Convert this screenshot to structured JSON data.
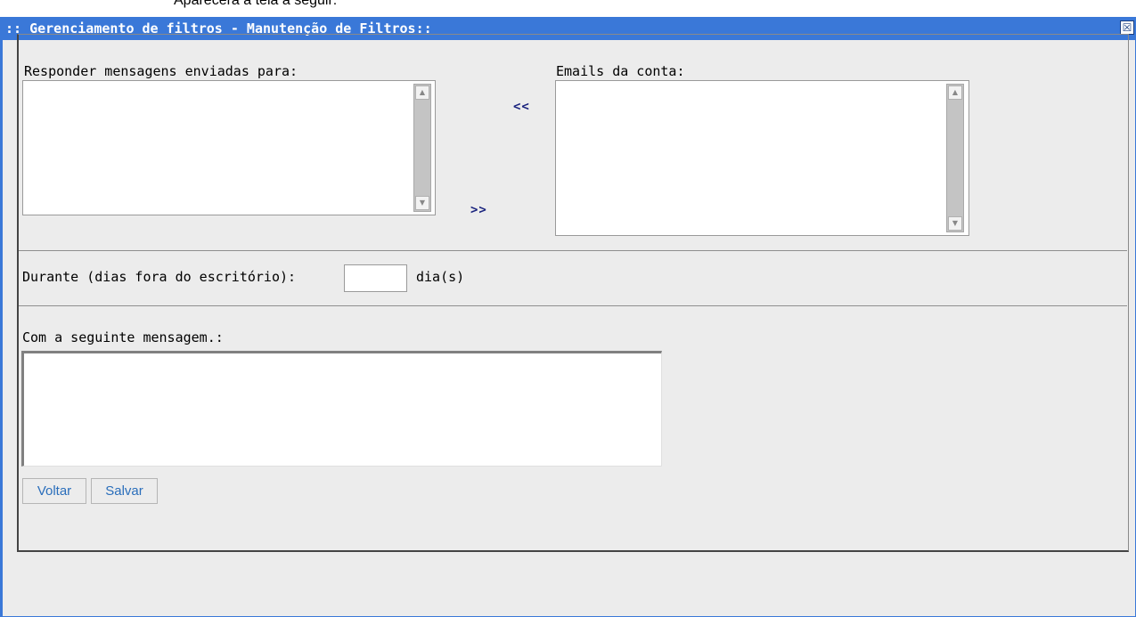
{
  "caption": "Aparecerá a tela a seguir:",
  "window": {
    "title": ":: Gerenciamento de filtros - Manutenção de Filtros::",
    "close_glyph": "☒"
  },
  "form": {
    "reply_to_label": "Responder mensagens enviadas para:",
    "account_emails_label": "Emails da conta:",
    "move_left": "<<",
    "move_right": ">>",
    "days_label": "Durante (dias fora do escritório):",
    "days_value": "",
    "days_unit": "dia(s)",
    "message_label": "Com a seguinte mensagem.:",
    "message_value": ""
  },
  "buttons": {
    "back": "Voltar",
    "save": "Salvar"
  },
  "colors": {
    "titlebar": "#3a78d8",
    "button_text": "#2a6ebb",
    "arrow_text": "#1a237e"
  }
}
